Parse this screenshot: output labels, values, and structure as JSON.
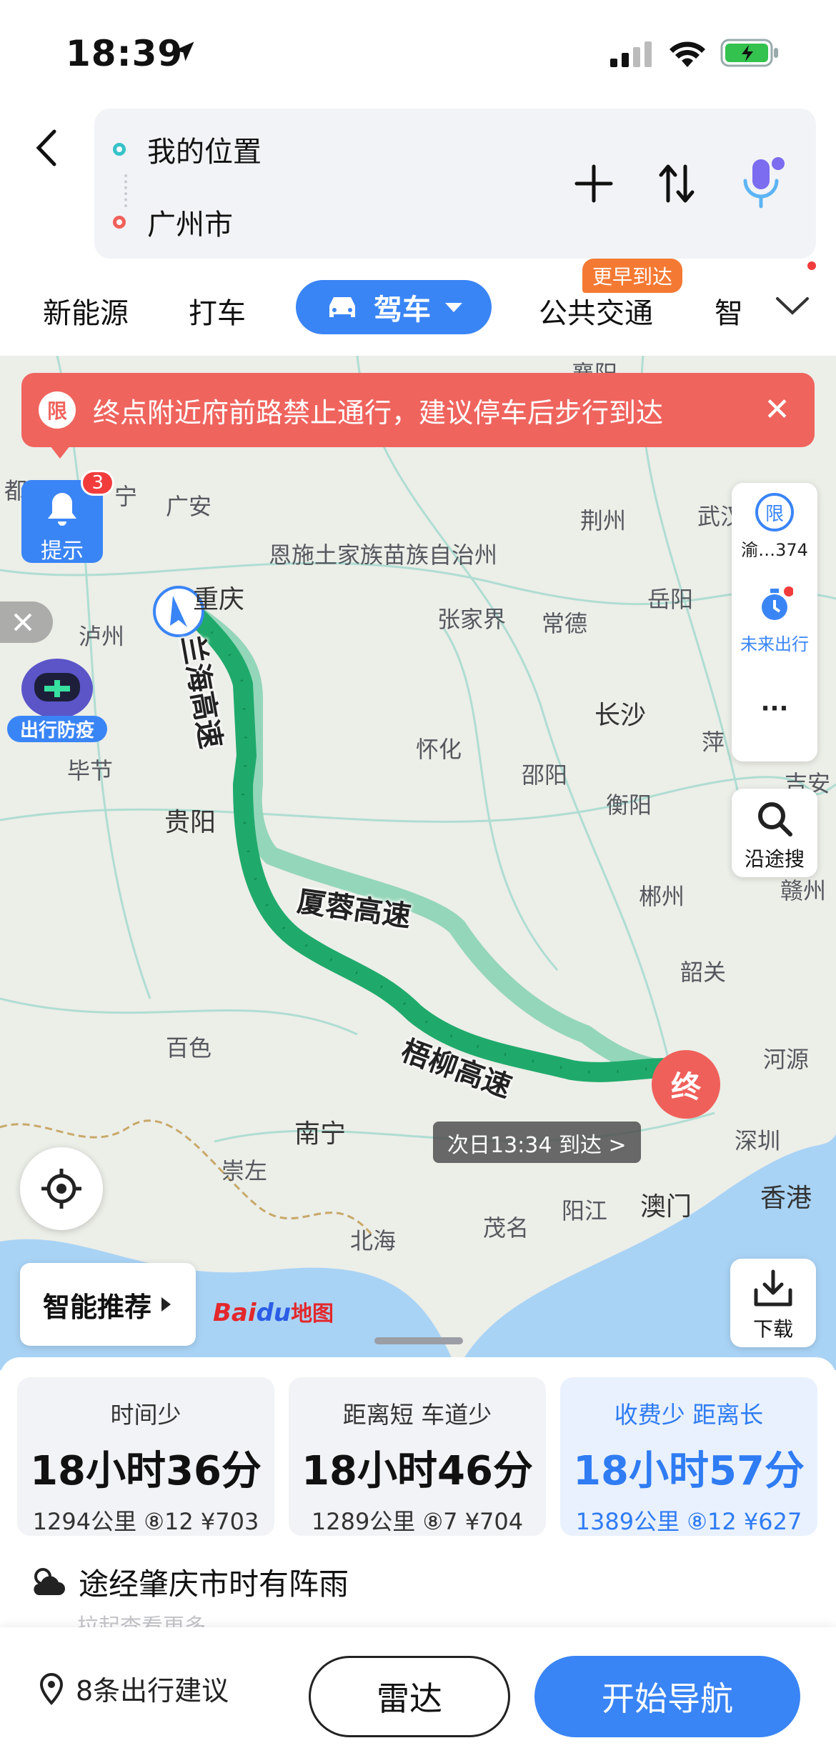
{
  "status": {
    "time": "18:39"
  },
  "route": {
    "start": "我的位置",
    "end": "广州市"
  },
  "modes": {
    "new_energy": "新能源",
    "taxi": "打车",
    "drive": "驾车",
    "transit": "公共交通",
    "transit_badge": "更早到达",
    "more": "智"
  },
  "alert": {
    "limit": "限",
    "text": "终点附近府前路禁止通行，建议停车后步行到达"
  },
  "tips": {
    "label": "提示",
    "count": "3"
  },
  "side": {
    "limit_label": "渝…374",
    "limit_icon": "限",
    "future": "未来出行",
    "more": "···",
    "along_search": "沿途搜"
  },
  "robot_label": "出行防疫",
  "map": {
    "places": [
      "襄阳",
      "荆州",
      "武汉",
      "广安",
      "恩施土家族苗族自治州",
      "重庆",
      "泸州",
      "张家界",
      "常德",
      "岳阳",
      "长沙",
      "怀化",
      "邵阳",
      "毕节",
      "贵阳",
      "衡阳",
      "萍",
      "吉安",
      "郴州",
      "赣州",
      "韶关",
      "百色",
      "南宁",
      "崇左",
      "河源",
      "深圳",
      "香港",
      "澳门",
      "阳江",
      "茂名",
      "北海",
      "都",
      "宁"
    ],
    "roads": [
      "兰海高速",
      "厦蓉高速",
      "梧柳高速"
    ],
    "end_pin": "终",
    "eta": "次日13:34 到达 >"
  },
  "smart": "智能推荐",
  "logo": {
    "a": "Bai",
    "b": "du",
    "c": "地图"
  },
  "download": "下载",
  "options": [
    {
      "header": "时间少",
      "duration": "18小时36分",
      "meta": "1294公里  ⑧12 ¥703"
    },
    {
      "header": "距离短  车道少",
      "duration": "18小时46分",
      "meta": "1289公里  ⑧7 ¥704"
    },
    {
      "header": "收费少  距离长",
      "duration": "18小时57分",
      "meta": "1389公里  ⑧12 ¥627"
    }
  ],
  "weather": {
    "text": "途经肇庆市时有阵雨",
    "sub": "拉起查看更多"
  },
  "bottom": {
    "suggest": "8条出行建议",
    "radar": "雷达",
    "go": "开始导航"
  },
  "colors": {
    "accent": "#3a85f6",
    "alert": "#f0645e",
    "route_main": "#1faa6b",
    "route_alt": "#8fd4b6"
  }
}
